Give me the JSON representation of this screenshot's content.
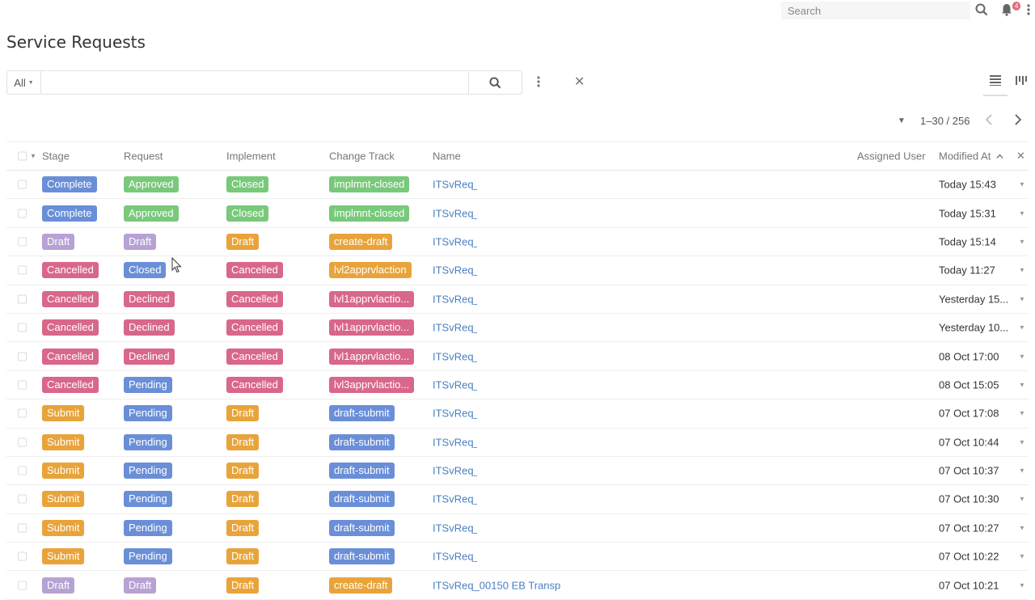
{
  "topbar": {
    "search_placeholder": "Search",
    "notification_count": "4",
    "icons": [
      "search-icon",
      "bell-icon",
      "more-vertical-icon"
    ]
  },
  "page": {
    "title": "Service Requests"
  },
  "filter": {
    "scope": "All",
    "query": ""
  },
  "pagination": {
    "range": "1–30 / 256"
  },
  "columns": {
    "stage": "Stage",
    "request": "Request",
    "implement": "Implement",
    "change_track": "Change Track",
    "name": "Name",
    "assigned_user": "Assigned User",
    "modified_at": "Modified At"
  },
  "colors": {
    "blue": "#6a8fd8",
    "green": "#78c97a",
    "purple": "#b7a2d4",
    "pink": "#d9678a",
    "orange": "#e8a43a"
  },
  "rows": [
    {
      "stage": "Complete",
      "stage_color": "blue",
      "request": "Approved",
      "request_color": "green",
      "implement": "Closed",
      "implement_color": "green",
      "track": "implmnt-closed",
      "track_color": "green",
      "name": "ITSvReq_(",
      "modified": "Today 15:43"
    },
    {
      "stage": "Complete",
      "stage_color": "blue",
      "request": "Approved",
      "request_color": "green",
      "implement": "Closed",
      "implement_color": "green",
      "track": "implmnt-closed",
      "track_color": "green",
      "name": "ITSvReq_(",
      "modified": "Today 15:31"
    },
    {
      "stage": "Draft",
      "stage_color": "purple",
      "request": "Draft",
      "request_color": "purple",
      "implement": "Draft",
      "implement_color": "orange",
      "track": "create-draft",
      "track_color": "orange",
      "name": "ITSvReq_(",
      "modified": "Today 15:14"
    },
    {
      "stage": "Cancelled",
      "stage_color": "pink",
      "request": "Closed",
      "request_color": "blue",
      "implement": "Cancelled",
      "implement_color": "pink",
      "track": "lvl2apprvlaction",
      "track_color": "orange",
      "name": "ITSvReq_(",
      "modified": "Today 11:27"
    },
    {
      "stage": "Cancelled",
      "stage_color": "pink",
      "request": "Declined",
      "request_color": "pink",
      "implement": "Cancelled",
      "implement_color": "pink",
      "track": "lvl1apprvlactio...",
      "track_color": "pink",
      "name": "ITSvReq_(",
      "modified": "Yesterday 15..."
    },
    {
      "stage": "Cancelled",
      "stage_color": "pink",
      "request": "Declined",
      "request_color": "pink",
      "implement": "Cancelled",
      "implement_color": "pink",
      "track": "lvl1apprvlactio...",
      "track_color": "pink",
      "name": "ITSvReq_(",
      "modified": "Yesterday 10..."
    },
    {
      "stage": "Cancelled",
      "stage_color": "pink",
      "request": "Declined",
      "request_color": "pink",
      "implement": "Cancelled",
      "implement_color": "pink",
      "track": "lvl1apprvlactio...",
      "track_color": "pink",
      "name": "ITSvReq_(",
      "modified": "08 Oct 17:00"
    },
    {
      "stage": "Cancelled",
      "stage_color": "pink",
      "request": "Pending",
      "request_color": "blue",
      "implement": "Cancelled",
      "implement_color": "pink",
      "track": "lvl3apprvlactio...",
      "track_color": "pink",
      "name": "ITSvReq_(",
      "modified": "08 Oct 15:05"
    },
    {
      "stage": "Submit",
      "stage_color": "orange",
      "request": "Pending",
      "request_color": "blue",
      "implement": "Draft",
      "implement_color": "orange",
      "track": "draft-submit",
      "track_color": "blue",
      "name": "ITSvReq_(",
      "modified": "07 Oct 17:08"
    },
    {
      "stage": "Submit",
      "stage_color": "orange",
      "request": "Pending",
      "request_color": "blue",
      "implement": "Draft",
      "implement_color": "orange",
      "track": "draft-submit",
      "track_color": "blue",
      "name": "ITSvReq_(",
      "modified": "07 Oct 10:44"
    },
    {
      "stage": "Submit",
      "stage_color": "orange",
      "request": "Pending",
      "request_color": "blue",
      "implement": "Draft",
      "implement_color": "orange",
      "track": "draft-submit",
      "track_color": "blue",
      "name": "ITSvReq_(",
      "modified": "07 Oct 10:37"
    },
    {
      "stage": "Submit",
      "stage_color": "orange",
      "request": "Pending",
      "request_color": "blue",
      "implement": "Draft",
      "implement_color": "orange",
      "track": "draft-submit",
      "track_color": "blue",
      "name": "ITSvReq_(",
      "modified": "07 Oct 10:30"
    },
    {
      "stage": "Submit",
      "stage_color": "orange",
      "request": "Pending",
      "request_color": "blue",
      "implement": "Draft",
      "implement_color": "orange",
      "track": "draft-submit",
      "track_color": "blue",
      "name": "ITSvReq_(",
      "modified": "07 Oct 10:27"
    },
    {
      "stage": "Submit",
      "stage_color": "orange",
      "request": "Pending",
      "request_color": "blue",
      "implement": "Draft",
      "implement_color": "orange",
      "track": "draft-submit",
      "track_color": "blue",
      "name": "ITSvReq_(",
      "modified": "07 Oct 10:22"
    },
    {
      "stage": "Draft",
      "stage_color": "purple",
      "request": "Draft",
      "request_color": "purple",
      "implement": "Draft",
      "implement_color": "orange",
      "track": "create-draft",
      "track_color": "orange",
      "name": "ITSvReq_00150 EB Transp",
      "modified": "07 Oct 10:21"
    }
  ]
}
